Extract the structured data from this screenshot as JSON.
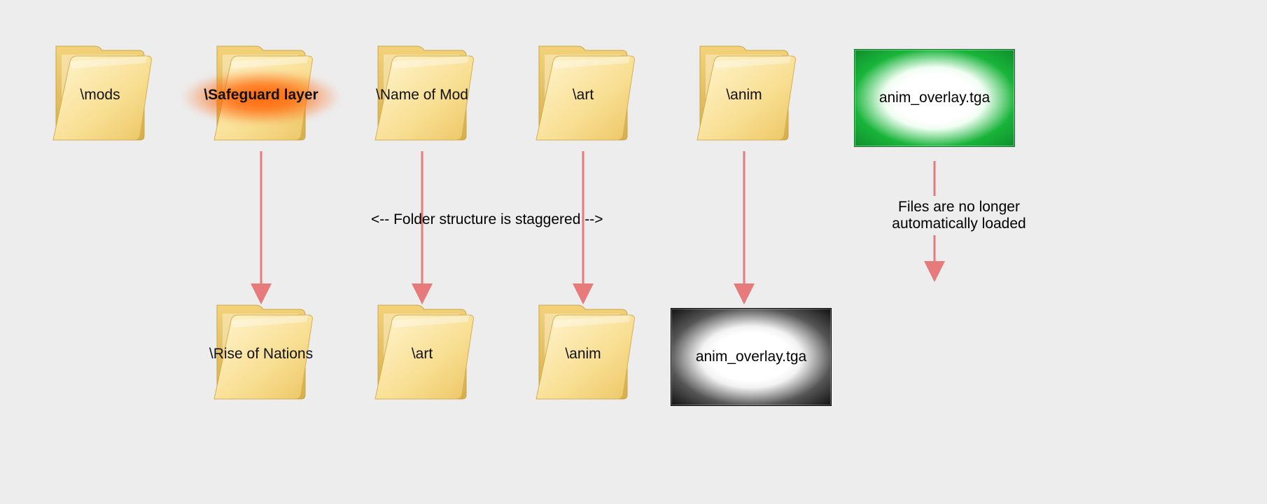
{
  "top_row": {
    "mods": "\\mods",
    "safeguard": "\\Safeguard layer",
    "name_of_mod": "\\Name of Mod",
    "art": "\\art",
    "anim": "\\anim",
    "file": "anim_overlay.tga"
  },
  "bottom_row": {
    "rise_of_nations": "\\Rise of Nations",
    "art": "\\art",
    "anim": "\\anim",
    "file": "anim_overlay.tga"
  },
  "notes": {
    "staggered": "<-- Folder structure is staggered -->",
    "no_load_line1": "Files are no longer",
    "no_load_line2": "automatically loaded"
  },
  "colors": {
    "arrow": "#e77a7a",
    "highlight": "#ff5f00",
    "green": "#19b43a",
    "black": "#111111"
  }
}
